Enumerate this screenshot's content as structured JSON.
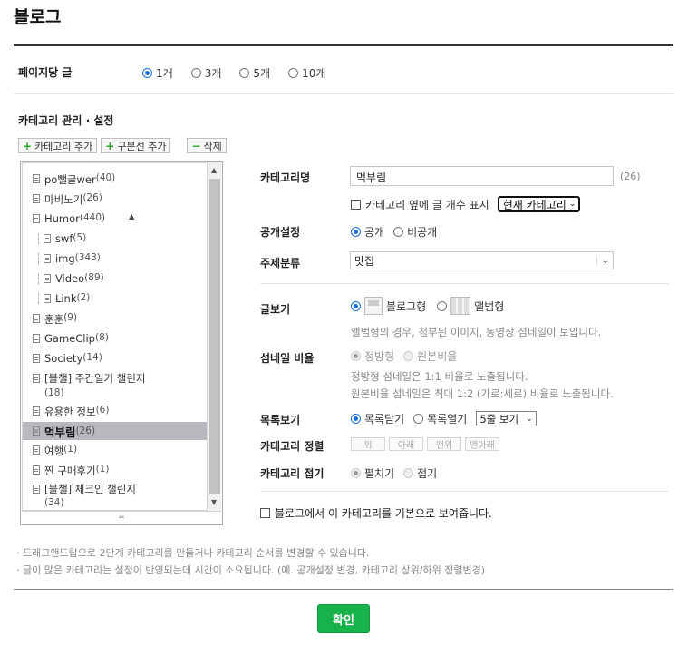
{
  "header": {
    "title": "블로그"
  },
  "posts_per_page": {
    "label": "페이지당 글",
    "options": [
      "1개",
      "3개",
      "5개",
      "10개"
    ],
    "selected": "1개"
  },
  "category_section": {
    "title": "카테고리 관리 · 설정",
    "toolbar": {
      "add_category": "카테고리 추가",
      "add_divider": "구분선 추가",
      "delete": "삭제"
    }
  },
  "tree": {
    "items": [
      {
        "name": "po뺄글wer",
        "count": "(40)"
      },
      {
        "name": "마비노기",
        "count": "(26)"
      },
      {
        "name": "Humor",
        "count": "(440)"
      },
      {
        "name": "swf",
        "count": "(5)"
      },
      {
        "name": "img",
        "count": "(343)"
      },
      {
        "name": "Video",
        "count": "(89)"
      },
      {
        "name": "Link",
        "count": "(2)"
      },
      {
        "name": "훈훈",
        "count": "(9)"
      },
      {
        "name": "GameClip",
        "count": "(8)"
      },
      {
        "name": "Society",
        "count": "(14)"
      },
      {
        "name": "[블챌] 주간일기 챌린지",
        "count": "(18)"
      },
      {
        "name": "유용한 정보",
        "count": "(6)"
      },
      {
        "name": "먹부림",
        "count": "(26)"
      },
      {
        "name": "여행",
        "count": "(1)"
      },
      {
        "name": "찐 구매후기",
        "count": "(1)"
      },
      {
        "name": "[블챌] 체크인 챌린지",
        "count": "(34)"
      }
    ],
    "selected": "먹부림"
  },
  "form": {
    "category_name": {
      "label": "카테고리명",
      "value": "먹부림",
      "count": "(26)"
    },
    "show_count": {
      "label": "카테고리 옆에 글 개수 표시",
      "select": "현재 카테고리"
    },
    "visibility": {
      "label": "공개설정",
      "options": [
        "공개",
        "비공개"
      ],
      "selected": "공개"
    },
    "topic": {
      "label": "주제분류",
      "value": "맛집"
    },
    "view": {
      "label": "글보기",
      "options": [
        "블로그형",
        "앨범형"
      ],
      "selected": "블로그형",
      "note": "앨범형의 경우, 첨부된 이미지, 동영상 섬네일이 보입니다."
    },
    "thumb_ratio": {
      "label": "섬네일 비율",
      "options": [
        "정방형",
        "원본비율"
      ],
      "selected": "정방형",
      "note1": "정방형 섬네일은 1:1 비율로 노출됩니다.",
      "note2": "원본비율 섬네일은 최대 1:2 (가로:세로) 비율로 노출됩니다."
    },
    "list_view": {
      "label": "목록보기",
      "options": [
        "목록닫기",
        "목록열기"
      ],
      "selected": "목록닫기",
      "rows": "5줄 보기"
    },
    "sort": {
      "label": "카테고리 정렬",
      "buttons": [
        "위",
        "아래",
        "맨위",
        "맨아래"
      ]
    },
    "fold": {
      "label": "카테고리 접기",
      "options": [
        "펼치기",
        "접기"
      ],
      "selected": "펼치기"
    },
    "default_show": "블로그에서 이 카테고리를 기본으로 보여줍니다."
  },
  "footer_notes": [
    "· 드래그앤드랍으로 2단계 카테고리를 만들거나 카테고리 순서를 변경할 수 있습니다.",
    "· 글이 많은 카테고리는 설정이 반영되는데 시간이 소요됩니다. (예. 공개설정 변경, 카테고리 상위/하위 정렬변경)"
  ],
  "confirm": "확인"
}
